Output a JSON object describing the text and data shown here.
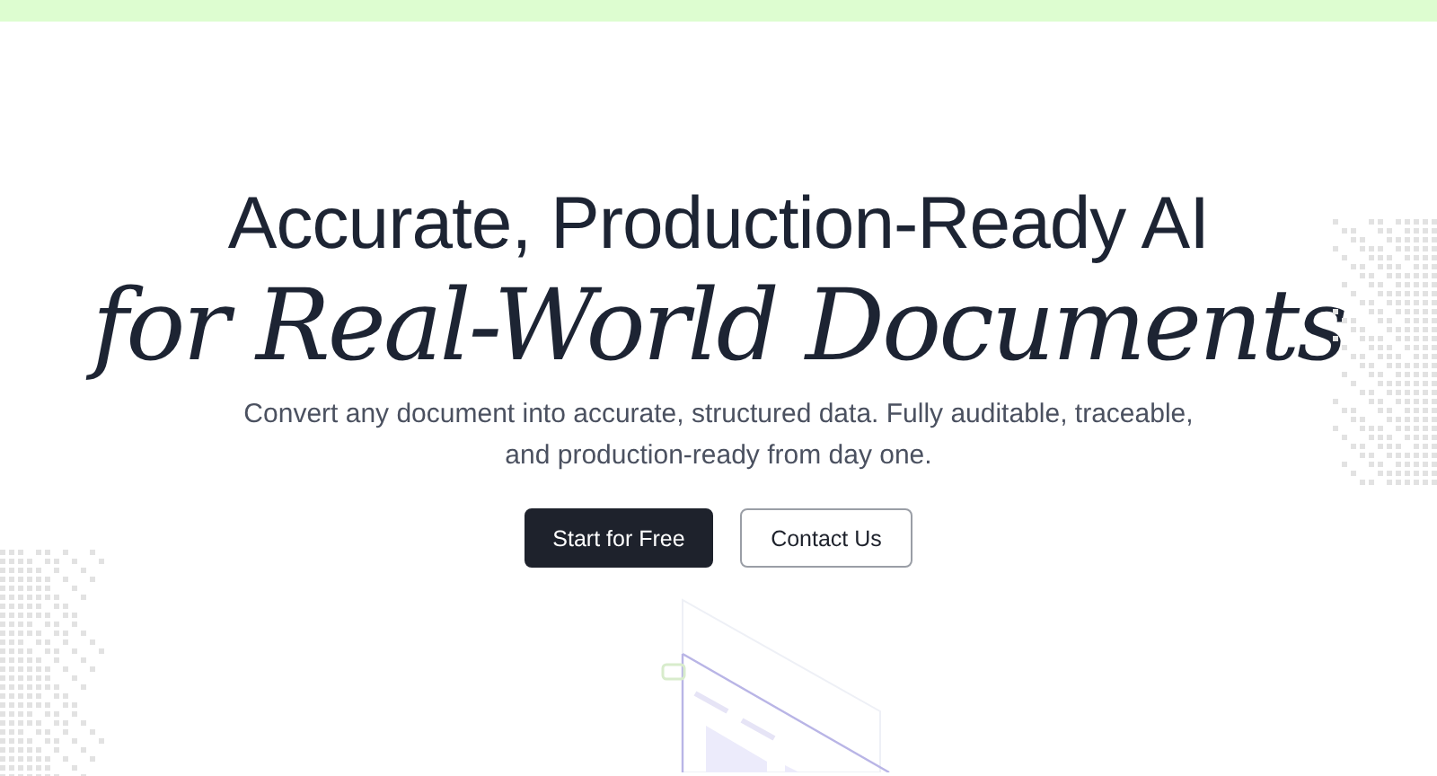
{
  "hero": {
    "title_line_1": "Accurate, Production-Ready AI",
    "title_line_2": "for Real-World Documents",
    "subtitle": "Convert any document into accurate, structured data. Fully auditable, traceable, and production-ready from day one."
  },
  "buttons": [
    {
      "label": "Start for Free",
      "kind": "primary"
    },
    {
      "label": "Contact Us",
      "kind": "secondary"
    }
  ]
}
